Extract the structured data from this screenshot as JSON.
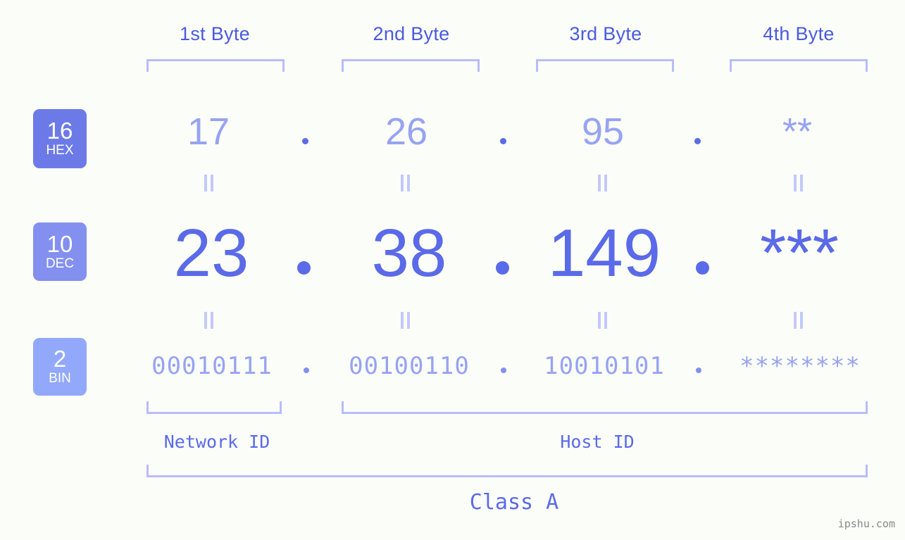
{
  "watermark": "ipshu.com",
  "byte_headers": [
    {
      "label": "1st Byte"
    },
    {
      "label": "2nd Byte"
    },
    {
      "label": "3rd Byte"
    },
    {
      "label": "4th Byte"
    }
  ],
  "bases": [
    {
      "num": "16",
      "label": "HEX",
      "color": "#6c7ae8"
    },
    {
      "num": "10",
      "label": "DEC",
      "color": "#8390f0"
    },
    {
      "num": "2",
      "label": "BIN",
      "color": "#92a8fb"
    }
  ],
  "rows": {
    "hex": {
      "values": [
        "17",
        "26",
        "95",
        "**"
      ],
      "separator": "."
    },
    "dec": {
      "values": [
        "23",
        "38",
        "149",
        "***"
      ],
      "separator": "."
    },
    "bin": {
      "values": [
        "00010111",
        "00100110",
        "10010101",
        "********"
      ],
      "separator": "."
    }
  },
  "segments": {
    "network_id": "Network ID",
    "host_id": "Host ID"
  },
  "class_label": "Class A",
  "colors": {
    "background": "#fbfdf8",
    "accent_strong": "#5a6ae8",
    "accent_light": "#97a3f2",
    "bracket": "#b7bdfb",
    "header_text": "#4a5ae0"
  }
}
